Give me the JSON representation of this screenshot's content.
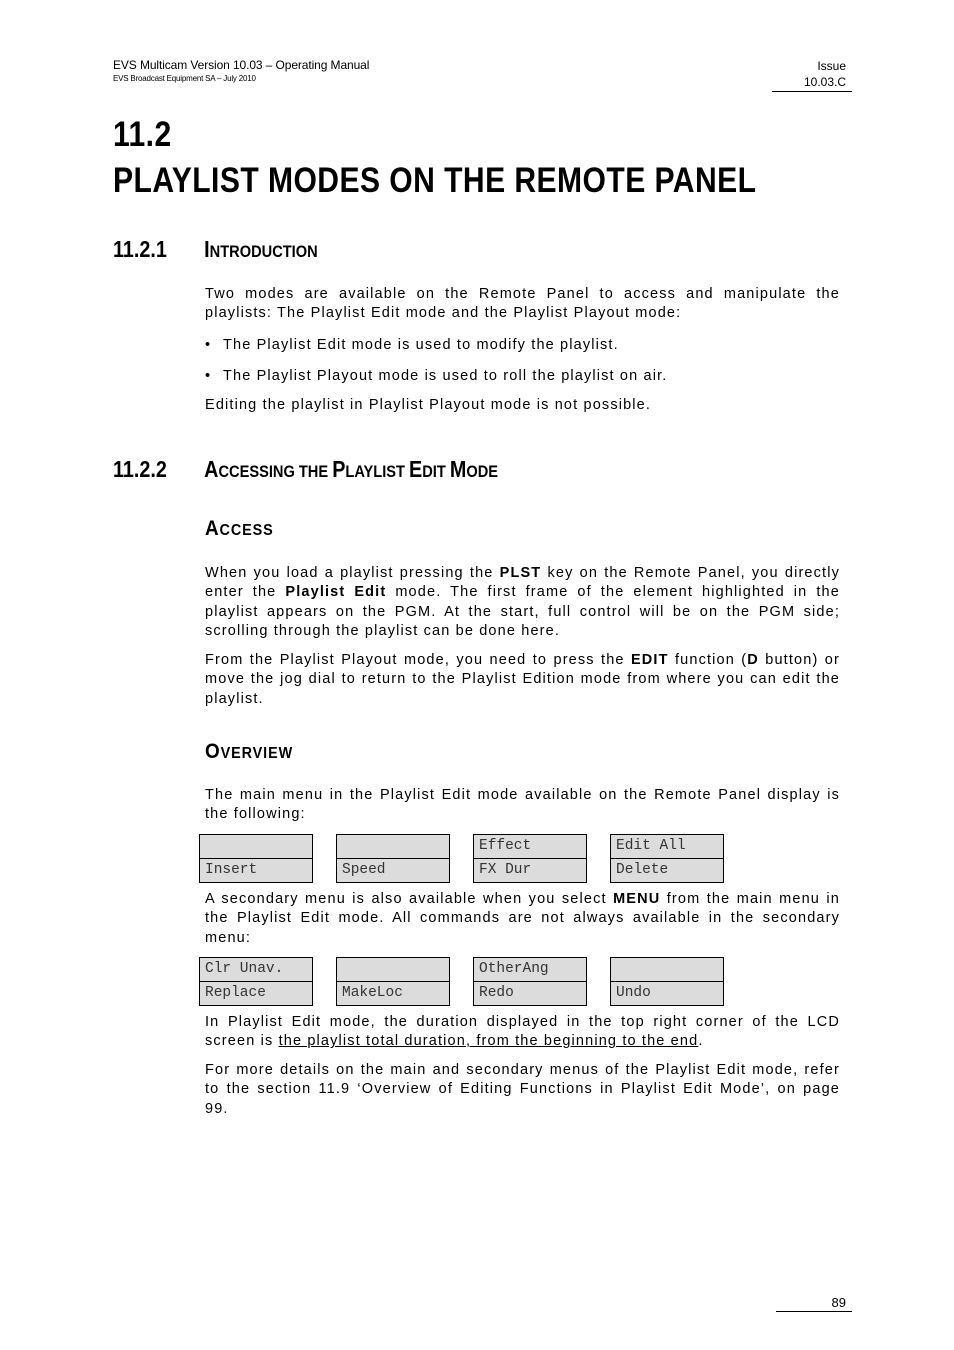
{
  "header": {
    "title": "EVS Multicam Version 10.03  – Operating Manual",
    "subtitle": "EVS Broadcast Equipment SA – July 2010",
    "issue_label": "Issue",
    "issue_value": "10.03.C"
  },
  "section": {
    "number": "11.2",
    "title": "PLAYLIST MODES ON THE REMOTE PANEL"
  },
  "intro": {
    "number": "11.2.1",
    "title_first": "I",
    "title_rest": "NTRODUCTION",
    "para1": "Two modes are available on the Remote Panel to access and manipulate the playlists: The Playlist Edit mode and the Playlist Playout mode:",
    "bullets": [
      "The Playlist Edit mode is used to modify the playlist.",
      "The Playlist Playout mode is used to roll the playlist on air."
    ],
    "para2": "Editing the playlist in Playlist Playout mode is not possible."
  },
  "accessing": {
    "number": "11.2.2",
    "title_parts": [
      {
        "cap": "A",
        "rest": "CCESSING THE "
      },
      {
        "cap": "P",
        "rest": "LAYLIST "
      },
      {
        "cap": "E",
        "rest": "DIT "
      },
      {
        "cap": "M",
        "rest": "ODE"
      }
    ],
    "access_heading": {
      "cap": "A",
      "rest": "CCESS"
    },
    "access_p1": {
      "a": "When you load a playlist pressing the ",
      "b": "PLST",
      "c": " key on the Remote Panel, you directly enter the ",
      "d": "Playlist Edit",
      "e": " mode. The first frame of the element highlighted in the playlist appears on the PGM. At the start, full control will be on the PGM side; scrolling through the playlist can be done here."
    },
    "access_p2": {
      "a": "From the Playlist Playout mode, you need to press the ",
      "b": "EDIT",
      "c": " function (",
      "d": "D",
      "e": " button) or move the jog dial to return to the Playlist Edition mode from where you can edit the playlist."
    },
    "overview_heading": {
      "cap": "O",
      "rest": "VERVIEW"
    },
    "overview_p1": "The main menu in the Playlist Edit mode available on the Remote Panel display is the following:",
    "main_menu": [
      {
        "top": "",
        "bottom": "Insert"
      },
      {
        "top": "",
        "bottom": "Speed"
      },
      {
        "top": "Effect",
        "bottom": "FX Dur"
      },
      {
        "top": "Edit All",
        "bottom": "Delete"
      }
    ],
    "overview_p2": {
      "a": "A secondary menu is also available when you select ",
      "b": "MENU",
      "c": " from the main menu in the Playlist Edit mode. All commands are not always available in the secondary menu:"
    },
    "secondary_menu": [
      {
        "top": "Clr Unav.",
        "bottom": "Replace"
      },
      {
        "top": "",
        "bottom": "MakeLoc"
      },
      {
        "top": "OtherAng",
        "bottom": "Redo"
      },
      {
        "top": "",
        "bottom": "Undo"
      }
    ],
    "overview_p3": {
      "a": "In Playlist Edit mode, the duration displayed in the top right corner of the LCD screen is ",
      "b": "the playlist total duration, from the beginning to the end",
      "c": "."
    },
    "overview_p4": "For more details on the main and secondary menus of the Playlist Edit mode, refer to the section 11.9 ‘Overview of Editing Functions in Playlist Edit Mode’, on page 99."
  },
  "footer": {
    "page_number": "89"
  }
}
